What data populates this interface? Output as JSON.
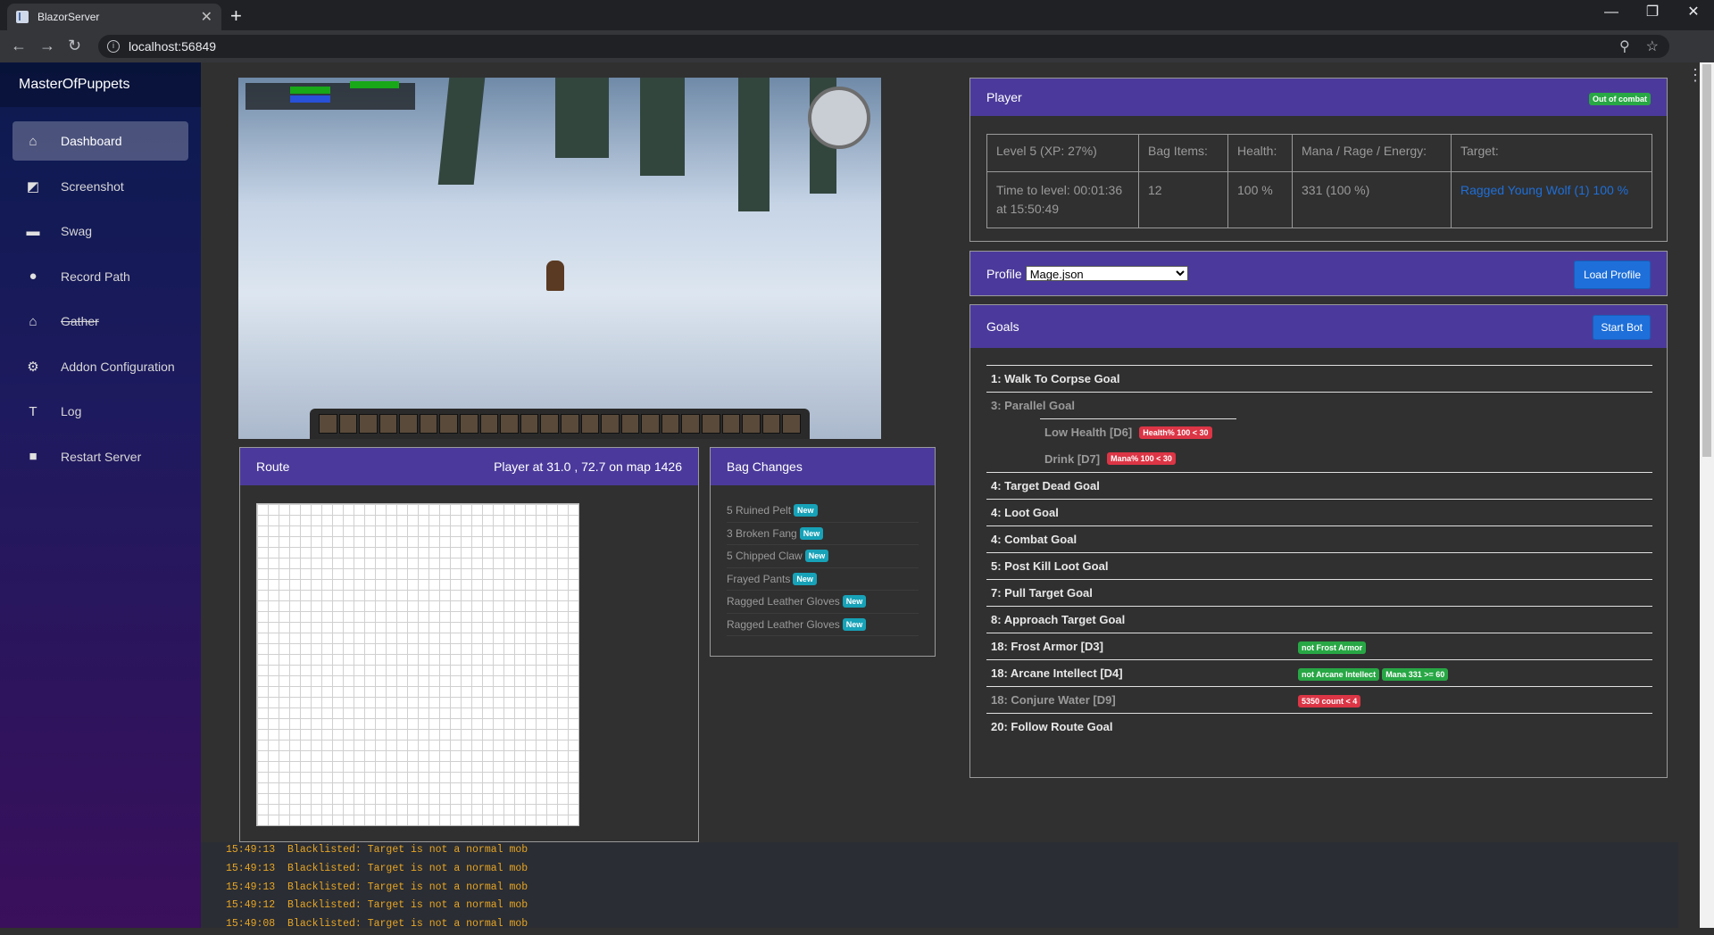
{
  "browser": {
    "tab_title": "BlazorServer",
    "tab_close": "✕",
    "new_tab": "+",
    "url": "localhost:56849",
    "window_buttons": [
      "—",
      "❐",
      "✕"
    ]
  },
  "sidebar": {
    "brand": "MasterOfPuppets",
    "items": [
      {
        "label": "Dashboard",
        "icon": "home-icon",
        "glyph": "⌂",
        "active": true
      },
      {
        "label": "Screenshot",
        "icon": "image-icon",
        "glyph": "◩"
      },
      {
        "label": "Swag",
        "icon": "folder-icon",
        "glyph": "▬"
      },
      {
        "label": "Record Path",
        "icon": "circle-icon",
        "glyph": "●"
      },
      {
        "label": "Gather",
        "icon": "home-strike-icon",
        "glyph": "⌂",
        "strike": true
      },
      {
        "label": "Addon Configuration",
        "icon": "gear-icon",
        "glyph": "⚙"
      },
      {
        "label": "Log",
        "icon": "text-icon",
        "glyph": "T"
      },
      {
        "label": "Restart Server",
        "icon": "square-icon",
        "glyph": "■"
      }
    ]
  },
  "route": {
    "title": "Route",
    "position": "Player at 31.0 , 72.7 on map 1426"
  },
  "bag": {
    "title": "Bag Changes",
    "items": [
      {
        "label": "5  Ruined Pelt",
        "badge": "New"
      },
      {
        "label": "3  Broken Fang",
        "badge": "New"
      },
      {
        "label": "5  Chipped Claw",
        "badge": "New"
      },
      {
        "label": "Frayed Pants",
        "badge": "New"
      },
      {
        "label": "Ragged Leather Gloves",
        "badge": "New"
      },
      {
        "label": "Ragged Leather Gloves",
        "badge": "New"
      }
    ]
  },
  "player": {
    "title": "Player",
    "status": "Out of combat",
    "headers": [
      "Level 5 (XP: 27%)",
      "Bag Items:",
      "Health:",
      "Mana / Rage / Energy:",
      "Target:"
    ],
    "values": [
      "Time to level: 00:01:36 at 15:50:49",
      "12",
      "100 %",
      "331 (100 %)",
      "Ragged Young Wolf (1) 100 %"
    ]
  },
  "profile": {
    "label": "Profile",
    "selected": "Mage.json",
    "load_button": "Load Profile"
  },
  "goals": {
    "title": "Goals",
    "start_button": "Start Bot",
    "rows": [
      {
        "label": "1: Walk To Corpse Goal",
        "dim": false
      },
      {
        "label": "3: Parallel Goal",
        "dim": true
      },
      {
        "label": "4: Target Dead Goal",
        "dim": false
      },
      {
        "label": "4: Loot Goal",
        "dim": false
      },
      {
        "label": "4: Combat Goal",
        "dim": false
      },
      {
        "label": "5: Post Kill Loot Goal",
        "dim": false
      },
      {
        "label": "7: Pull Target Goal",
        "dim": false
      },
      {
        "label": "8: Approach Target Goal",
        "dim": false
      },
      {
        "label": "18: Frost Armor [D3]",
        "dim": false,
        "badges": [
          {
            "text": "not Frost Armor",
            "color": "green"
          }
        ]
      },
      {
        "label": "18: Arcane Intellect [D4]",
        "dim": false,
        "badges": [
          {
            "text": "not Arcane Intellect",
            "color": "green"
          },
          {
            "text": "Mana 331 >= 60",
            "color": "green"
          }
        ]
      },
      {
        "label": "18: Conjure Water [D9]",
        "dim": true,
        "badges": [
          {
            "text": "5350 count < 4",
            "color": "red"
          }
        ]
      },
      {
        "label": "20: Follow Route Goal",
        "dim": false
      }
    ],
    "parallel": [
      {
        "label": "Low Health [D6]",
        "badge": "Health% 100 < 30"
      },
      {
        "label": "Drink [D7]",
        "badge": "Mana% 100 < 30"
      }
    ]
  },
  "log": [
    "15:49:13  Blacklisted: Target is not a normal mob",
    "15:49:13  Blacklisted: Target is not a normal mob",
    "15:49:13  Blacklisted: Target is not a normal mob",
    "15:49:12  Blacklisted: Target is not a normal mob",
    "15:49:08  Blacklisted: Target is not a normal mob"
  ]
}
